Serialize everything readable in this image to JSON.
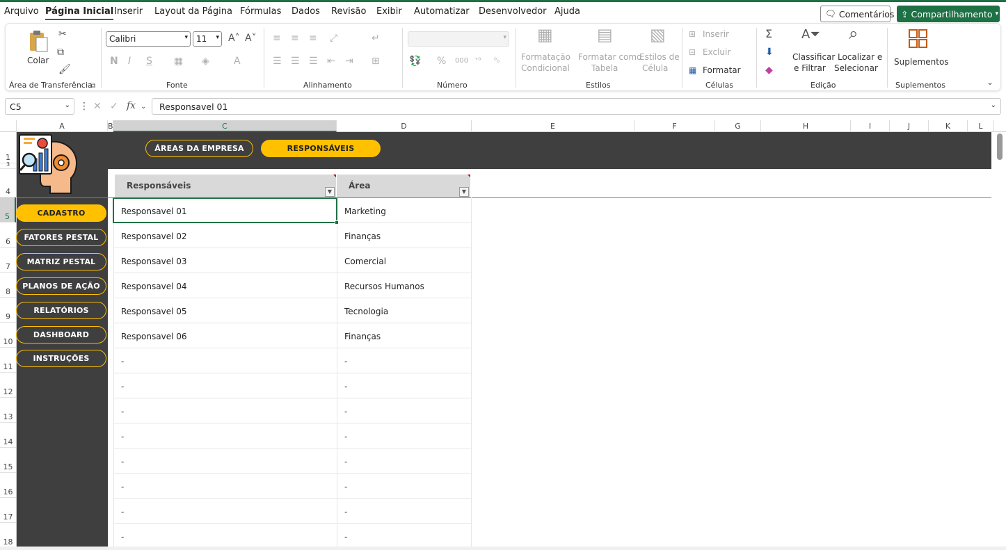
{
  "menu": {
    "items": [
      "Arquivo",
      "Página Inicial",
      "Inserir",
      "Layout da Página",
      "Fórmulas",
      "Dados",
      "Revisão",
      "Exibir",
      "Automatizar",
      "Desenvolvedor",
      "Ajuda"
    ],
    "comments_label": "Comentários",
    "share_label": "Compartilhamento"
  },
  "ribbon": {
    "clipboard": {
      "paste_label": "Colar",
      "group": "Área de Transferência"
    },
    "font": {
      "name": "Calibri",
      "size": "11",
      "group": "Fonte"
    },
    "alignment": {
      "group": "Alinhamento"
    },
    "number": {
      "group": "Número",
      "format": ""
    },
    "styles": {
      "conditional_l1": "Formatação",
      "conditional_l2": "Condicional",
      "table_l1": "Formatar como",
      "table_l2": "Tabela",
      "cell_l1": "Estilos de",
      "cell_l2": "Célula",
      "group": "Estilos"
    },
    "cells": {
      "insert": "Inserir",
      "delete": "Excluir",
      "format": "Formatar",
      "group": "Células"
    },
    "editing": {
      "sort_l1": "Classificar",
      "sort_l2": "e Filtrar",
      "find_l1": "Localizar e",
      "find_l2": "Selecionar",
      "group": "Edição"
    },
    "addins": {
      "label": "Suplementos",
      "group": "Suplementos"
    }
  },
  "formula_bar": {
    "name_box": "C5",
    "fx": "fx",
    "value": "Responsavel 01"
  },
  "columns": [
    "A",
    "B",
    "C",
    "D",
    "E",
    "F",
    "G",
    "H",
    "I",
    "J",
    "K",
    "L"
  ],
  "rows": [
    "1",
    "3",
    "4",
    "5",
    "6",
    "7",
    "8",
    "9",
    "10",
    "11",
    "12",
    "13",
    "14",
    "15",
    "16",
    "17",
    "18"
  ],
  "top_tabs": [
    "ÁREAS DA EMPRESA",
    "RESPONSÁVEIS"
  ],
  "side_nav": [
    "CADASTRO",
    "FATORES PESTAL",
    "MATRIZ PESTAL",
    "PLANOS DE AÇÃO",
    "RELATÓRIOS",
    "DASHBOARD",
    "INSTRUÇÕES"
  ],
  "table": {
    "headers": [
      "Responsáveis",
      "Área"
    ],
    "rows": [
      [
        "Responsavel 01",
        "Marketing"
      ],
      [
        "Responsavel 02",
        "Finanças"
      ],
      [
        "Responsavel 03",
        "Comercial"
      ],
      [
        "Responsavel 04",
        "Recursos Humanos"
      ],
      [
        "Responsavel 05",
        "Tecnologia"
      ],
      [
        "Responsavel 06",
        "Finanças"
      ],
      [
        "-",
        "-"
      ],
      [
        "-",
        "-"
      ],
      [
        "-",
        "-"
      ],
      [
        "-",
        "-"
      ],
      [
        "-",
        "-"
      ],
      [
        "-",
        "-"
      ],
      [
        "-",
        "-"
      ],
      [
        "-",
        "-"
      ]
    ]
  },
  "colors": {
    "accent": "#ffc000",
    "dark_bg": "#3f3f3f",
    "excel_green": "#1e7145"
  }
}
